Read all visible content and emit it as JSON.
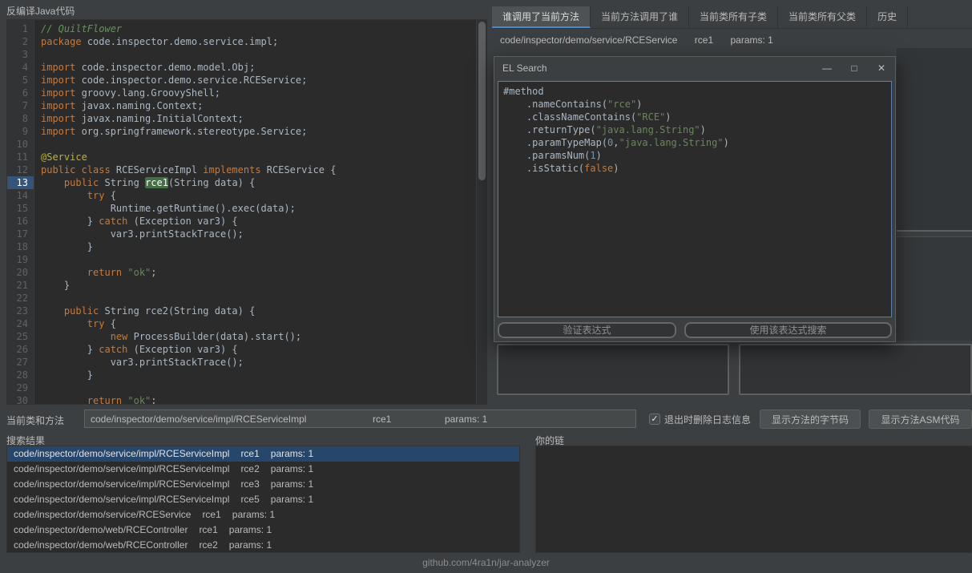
{
  "colors": {
    "accent": "#4a88c7",
    "selection_blue": "#26466b",
    "method_highlight": "#456e46",
    "keyword_orange": "#cc7832",
    "string_green": "#6a8759"
  },
  "editor": {
    "title": "反编译Java代码",
    "lines": [
      {
        "segs": [
          {
            "t": "// QuiltFlower",
            "c": "cm"
          }
        ]
      },
      {
        "segs": [
          {
            "t": "package ",
            "c": "kw"
          },
          {
            "t": "code.inspector.demo.service.impl;",
            "c": "pl"
          }
        ]
      },
      {
        "segs": []
      },
      {
        "segs": [
          {
            "t": "import ",
            "c": "kw"
          },
          {
            "t": "code.inspector.demo.model.Obj;",
            "c": "pl"
          }
        ]
      },
      {
        "segs": [
          {
            "t": "import ",
            "c": "kw"
          },
          {
            "t": "code.inspector.demo.service.RCEService;",
            "c": "pl"
          }
        ]
      },
      {
        "segs": [
          {
            "t": "import ",
            "c": "kw"
          },
          {
            "t": "groovy.lang.GroovyShell;",
            "c": "pl"
          }
        ]
      },
      {
        "segs": [
          {
            "t": "import ",
            "c": "kw"
          },
          {
            "t": "javax.naming.Context;",
            "c": "pl"
          }
        ]
      },
      {
        "segs": [
          {
            "t": "import ",
            "c": "kw"
          },
          {
            "t": "javax.naming.InitialContext;",
            "c": "pl"
          }
        ]
      },
      {
        "segs": [
          {
            "t": "import ",
            "c": "kw"
          },
          {
            "t": "org.springframework.stereotype.Service;",
            "c": "pl"
          }
        ]
      },
      {
        "segs": []
      },
      {
        "segs": [
          {
            "t": "@Service",
            "c": "an"
          }
        ]
      },
      {
        "segs": [
          {
            "t": "public class ",
            "c": "kw"
          },
          {
            "t": "RCEServiceImpl ",
            "c": "pl"
          },
          {
            "t": "implements ",
            "c": "kw"
          },
          {
            "t": "RCEService {",
            "c": "pl"
          }
        ]
      },
      {
        "active": true,
        "segs": [
          {
            "t": "    ",
            "c": "pl"
          },
          {
            "t": "public ",
            "c": "kw"
          },
          {
            "t": "String ",
            "c": "pl"
          },
          {
            "t": "rce1",
            "c": "hl"
          },
          {
            "t": "(String data) {",
            "c": "pl"
          }
        ]
      },
      {
        "segs": [
          {
            "t": "        ",
            "c": "pl"
          },
          {
            "t": "try ",
            "c": "kw"
          },
          {
            "t": "{",
            "c": "pl"
          }
        ]
      },
      {
        "segs": [
          {
            "t": "            Runtime.getRuntime().exec(data);",
            "c": "pl"
          }
        ]
      },
      {
        "segs": [
          {
            "t": "        } ",
            "c": "pl"
          },
          {
            "t": "catch ",
            "c": "kw"
          },
          {
            "t": "(Exception var3) {",
            "c": "pl"
          }
        ]
      },
      {
        "segs": [
          {
            "t": "            var3.printStackTrace();",
            "c": "pl"
          }
        ]
      },
      {
        "segs": [
          {
            "t": "        }",
            "c": "pl"
          }
        ]
      },
      {
        "segs": []
      },
      {
        "segs": [
          {
            "t": "        ",
            "c": "pl"
          },
          {
            "t": "return ",
            "c": "kw"
          },
          {
            "t": "\"ok\"",
            "c": "st"
          },
          {
            "t": ";",
            "c": "pl"
          }
        ]
      },
      {
        "segs": [
          {
            "t": "    }",
            "c": "pl"
          }
        ]
      },
      {
        "segs": []
      },
      {
        "segs": [
          {
            "t": "    ",
            "c": "pl"
          },
          {
            "t": "public ",
            "c": "kw"
          },
          {
            "t": "String rce2(String data) {",
            "c": "pl"
          }
        ]
      },
      {
        "segs": [
          {
            "t": "        ",
            "c": "pl"
          },
          {
            "t": "try ",
            "c": "kw"
          },
          {
            "t": "{",
            "c": "pl"
          }
        ]
      },
      {
        "segs": [
          {
            "t": "            ",
            "c": "pl"
          },
          {
            "t": "new ",
            "c": "kw"
          },
          {
            "t": "ProcessBuilder(data).start();",
            "c": "pl"
          }
        ]
      },
      {
        "segs": [
          {
            "t": "        } ",
            "c": "pl"
          },
          {
            "t": "catch ",
            "c": "kw"
          },
          {
            "t": "(Exception var3) {",
            "c": "pl"
          }
        ]
      },
      {
        "segs": [
          {
            "t": "            var3.printStackTrace();",
            "c": "pl"
          }
        ]
      },
      {
        "segs": [
          {
            "t": "        }",
            "c": "pl"
          }
        ]
      },
      {
        "segs": []
      },
      {
        "segs": [
          {
            "t": "        ",
            "c": "pl"
          },
          {
            "t": "return ",
            "c": "kw"
          },
          {
            "t": "\"ok\"",
            "c": "st"
          },
          {
            "t": ";",
            "c": "pl"
          }
        ]
      }
    ]
  },
  "tabs": {
    "selected": 0,
    "items": [
      "谁调用了当前方法",
      "当前方法调用了谁",
      "当前类所有子类",
      "当前类所有父类",
      "历史"
    ]
  },
  "breadcrumb": {
    "cls": "code/inspector/demo/service/RCEService",
    "method": "rce1",
    "params": "params: 1"
  },
  "dialog": {
    "title": "EL Search",
    "minimize_icon": "—",
    "maximize_icon": "□",
    "close_icon": "✕",
    "expression": [
      {
        "segs": [
          {
            "t": "#method",
            "c": "pl"
          }
        ]
      },
      {
        "segs": [
          {
            "t": "    .nameContains(",
            "c": "pl"
          },
          {
            "t": "\"rce\"",
            "c": "st"
          },
          {
            "t": ")",
            "c": "pl"
          }
        ]
      },
      {
        "segs": [
          {
            "t": "    .classNameContains(",
            "c": "pl"
          },
          {
            "t": "\"RCE\"",
            "c": "st"
          },
          {
            "t": ")",
            "c": "pl"
          }
        ]
      },
      {
        "segs": [
          {
            "t": "    .returnType(",
            "c": "pl"
          },
          {
            "t": "\"java.lang.String\"",
            "c": "st"
          },
          {
            "t": ")",
            "c": "pl"
          }
        ]
      },
      {
        "segs": [
          {
            "t": "    .paramTypeMap(",
            "c": "pl"
          },
          {
            "t": "0",
            "c": "num"
          },
          {
            "t": ",",
            "c": "pl"
          },
          {
            "t": "\"java.lang.String\"",
            "c": "st"
          },
          {
            "t": ")",
            "c": "pl"
          }
        ]
      },
      {
        "segs": [
          {
            "t": "    .paramsNum(",
            "c": "pl"
          },
          {
            "t": "1",
            "c": "num"
          },
          {
            "t": ")",
            "c": "pl"
          }
        ]
      },
      {
        "segs": [
          {
            "t": "    .isStatic(",
            "c": "pl"
          },
          {
            "t": "false",
            "c": "kw"
          },
          {
            "t": ")",
            "c": "pl"
          }
        ]
      }
    ],
    "validate_label": "验证表达式",
    "search_label": "使用该表达式搜索"
  },
  "current": {
    "label": "当前类和方法",
    "cls": "code/inspector/demo/service/impl/RCEServiceImpl",
    "method": "rce1",
    "params": "params: 1",
    "checkbox_label": "退出时删除日志信息",
    "checkbox_checked": true,
    "check_icon": "✓",
    "bytecode_label": "显示方法的字节码",
    "asm_label": "显示方法ASM代码"
  },
  "results": {
    "label": "搜索结果",
    "items": [
      {
        "cls": "code/inspector/demo/service/impl/RCEServiceImpl",
        "method": "rce1",
        "params": "params: 1",
        "selected": true
      },
      {
        "cls": "code/inspector/demo/service/impl/RCEServiceImpl",
        "method": "rce2",
        "params": "params: 1",
        "selected": false
      },
      {
        "cls": "code/inspector/demo/service/impl/RCEServiceImpl",
        "method": "rce3",
        "params": "params: 1",
        "selected": false
      },
      {
        "cls": "code/inspector/demo/service/impl/RCEServiceImpl",
        "method": "rce5",
        "params": "params: 1",
        "selected": false
      },
      {
        "cls": "code/inspector/demo/service/RCEService",
        "method": "rce1",
        "params": "params: 1",
        "selected": false
      },
      {
        "cls": "code/inspector/demo/web/RCEController",
        "method": "rce1",
        "params": "params: 1",
        "selected": false
      },
      {
        "cls": "code/inspector/demo/web/RCEController",
        "method": "rce2",
        "params": "params: 1",
        "selected": false
      }
    ]
  },
  "chain": {
    "label": "你的链"
  },
  "footer": "github.com/4ra1n/jar-analyzer"
}
